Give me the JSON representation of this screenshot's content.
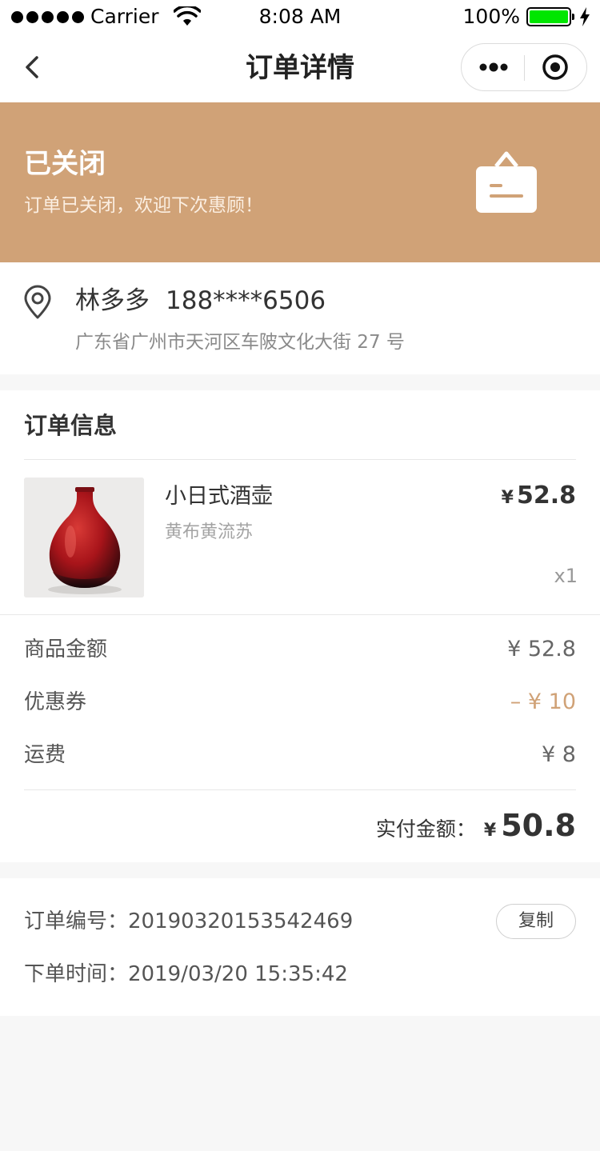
{
  "status_bar": {
    "carrier": "Carrier",
    "time": "8:08 AM",
    "battery": "100%",
    "battery_level": 1.0,
    "battery_color": "#00e600"
  },
  "nav": {
    "title": "订单详情",
    "back_icon": "chevron-left-icon",
    "more_icon": "more-dots-icon",
    "close_icon": "target-circle-icon"
  },
  "order_status": {
    "title": "已关闭",
    "subtitle": "订单已关闭，欢迎下次惠顾！",
    "icon": "shopping-bag-icon",
    "color": "#d0a277"
  },
  "address": {
    "icon": "location-pin-icon",
    "name": "林多多",
    "phone": "188****6506",
    "detail": "广东省广州市天河区车陂文化大街 27 号"
  },
  "order_info": {
    "title": "订单信息",
    "product": {
      "name": "小日式酒壶",
      "spec": "黄布黄流苏",
      "currency": "¥",
      "price": "52.8",
      "quantity": "x1"
    },
    "fees": [
      {
        "label": "商品金额",
        "value": "¥ 52.8"
      },
      {
        "label": "优惠券",
        "value": "– ¥ 10"
      },
      {
        "label": "运费",
        "value": "¥ 8"
      }
    ],
    "total_label": "实付金额：",
    "total_currency": "¥",
    "total_value": "50.8",
    "accent_color": "#d0a277"
  },
  "meta": {
    "order_no_label": "订单编号：",
    "order_no": "20190320153542469",
    "copy_label": "复制",
    "time_label": "下单时间：",
    "time": "2019/03/20 15:35:42"
  }
}
